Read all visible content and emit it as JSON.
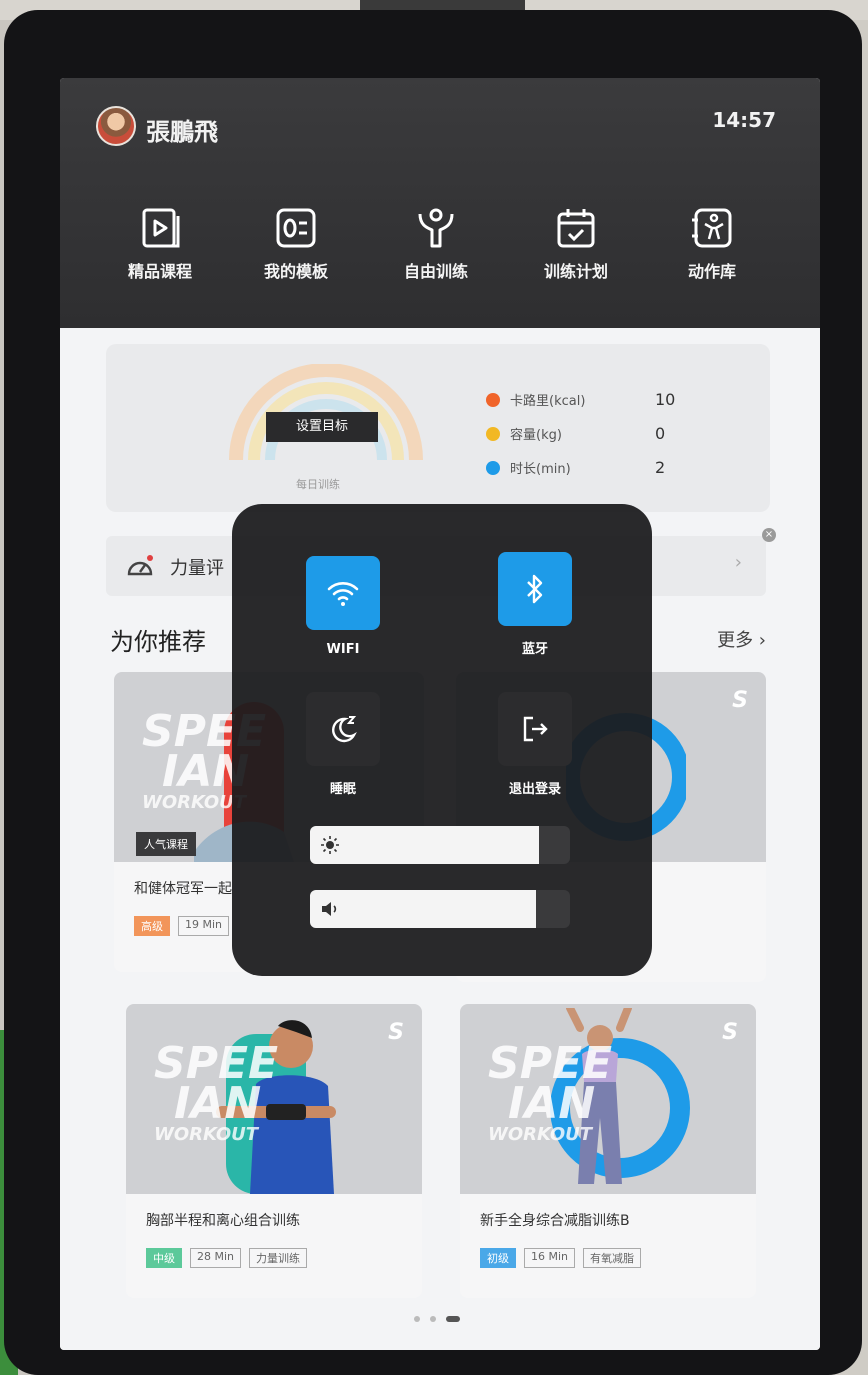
{
  "header": {
    "user_name": "張鵬飛",
    "time": "14:57",
    "nav": [
      {
        "label": "精品课程",
        "icon": "play-course-icon"
      },
      {
        "label": "我的模板",
        "icon": "template-icon"
      },
      {
        "label": "自由训练",
        "icon": "free-training-icon"
      },
      {
        "label": "训练计划",
        "icon": "calendar-check-icon"
      },
      {
        "label": "动作库",
        "icon": "exercise-library-icon"
      }
    ]
  },
  "goal_card": {
    "set_goal_label": "设置目标",
    "daily_label": "每日训练",
    "stats": [
      {
        "label": "卡路里(kcal)",
        "value": "10",
        "color": "#f0642a"
      },
      {
        "label": "容量(kg)",
        "value": "0",
        "color": "#f2b824"
      },
      {
        "label": "时长(min)",
        "value": "2",
        "color": "#1e9be8"
      }
    ]
  },
  "power_row": {
    "label": "力量评"
  },
  "recommend": {
    "title": "为你推荐",
    "more": "更多",
    "watermark": {
      "line1": "SPEE",
      "line2": "IAN",
      "line3": "WORKOUT"
    },
    "cards": [
      {
        "title": "和健体冠军一起",
        "tag_popular": "人气课程",
        "level": "高级",
        "level_color": "#f2955a",
        "duration": "19 Min",
        "type": ""
      },
      {
        "title": "",
        "level": "",
        "duration": "",
        "type": ""
      },
      {
        "title": "胸部半程和离心组合训练",
        "level": "中级",
        "level_color": "#5cc99a",
        "duration": "28 Min",
        "type": "力量训练"
      },
      {
        "title": "新手全身综合减脂训练B",
        "level": "初级",
        "level_color": "#4aa8e8",
        "duration": "16 Min",
        "type": "有氧减脂"
      }
    ]
  },
  "control_center": {
    "wifi": {
      "label": "WIFI",
      "state": "on"
    },
    "bluetooth": {
      "label": "蓝牙",
      "state": "on"
    },
    "sleep": {
      "label": "睡眠"
    },
    "logout": {
      "label": "退出登录"
    },
    "brightness": 0.88,
    "volume": 0.87,
    "accent": "#1e9be8"
  },
  "pagination": {
    "pages": 3,
    "current": 3
  }
}
